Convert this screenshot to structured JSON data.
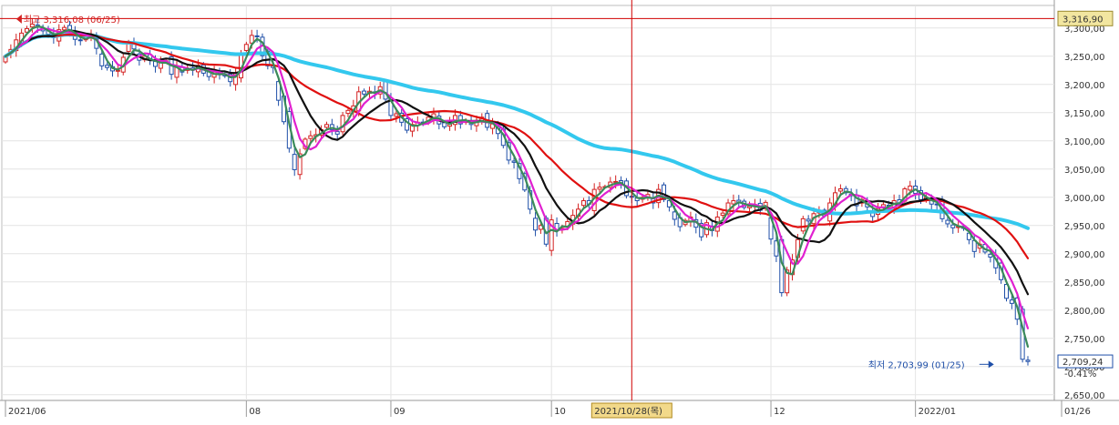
{
  "colors": {
    "up": "#d32020",
    "down": "#1f4fa8",
    "crosshair": "#d00000",
    "grid": "#e4e4e4",
    "ma_green": "#3b8a5a",
    "ma_magenta": "#e020d0",
    "ma_black": "#111111",
    "ma_red": "#e01010",
    "ma_cyan": "#33c8ee",
    "current_box": "#f2e6a0",
    "date_box": "#f2d98a"
  },
  "chart_data": {
    "type": "candlestick",
    "y_ticks": [
      "3,300,00",
      "3,250,00",
      "3,200,00",
      "3,150,00",
      "3,100,00",
      "3,050,00",
      "3,000,00",
      "2,950,00",
      "2,900,00",
      "2,850,00",
      "2,800,00",
      "2,750,00",
      "2,700,00",
      "2,650,00"
    ],
    "y_tick_values": [
      3300,
      3250,
      3200,
      3150,
      3100,
      3050,
      3000,
      2950,
      2900,
      2850,
      2800,
      2750,
      2700,
      2650
    ],
    "ylim": [
      2640,
      3340
    ],
    "x_ticks": [
      {
        "label": "2021/06",
        "date": "2021-06"
      },
      {
        "label": "08",
        "date": "2021-08"
      },
      {
        "label": "09",
        "date": "2021-09"
      },
      {
        "label": "10",
        "date": "2021-10"
      },
      {
        "label": "12",
        "date": "2021-12"
      },
      {
        "label": "2022/01",
        "date": "2022-01"
      },
      {
        "label": "01/26",
        "date": "2022-01-26"
      }
    ],
    "x_tick_index": [
      0,
      45,
      72,
      102,
      143,
      170,
      195
    ],
    "high_annotation": {
      "text": "최고 3,316,08 (06/25)",
      "value": 3316.08,
      "date": "06/25",
      "index": 1
    },
    "low_annotation": {
      "text": "최저 2,703,99 (01/25)",
      "value": 2703.99,
      "date": "01/25",
      "index": 185
    },
    "current_price": {
      "label": "3,316,90",
      "value": 3316.9
    },
    "last_price": {
      "label": "2,709,24",
      "value": 2709.24
    },
    "last_change": "-0.41%",
    "crosshair": {
      "label": "2021/10/28(목)",
      "index": 117
    },
    "close": [
      3250,
      3262,
      3279,
      3291,
      3299,
      3307,
      3302,
      3295,
      3289,
      3283,
      3297,
      3301,
      3293,
      3280,
      3278,
      3285,
      3288,
      3264,
      3233,
      3230,
      3224,
      3225,
      3248,
      3272,
      3263,
      3243,
      3250,
      3243,
      3232,
      3241,
      3242,
      3218,
      3232,
      3222,
      3229,
      3226,
      3234,
      3220,
      3214,
      3222,
      3218,
      3215,
      3205,
      3220,
      3253,
      3271,
      3287,
      3285,
      3251,
      3233,
      3230,
      3172,
      3134,
      3087,
      3049,
      3077,
      3103,
      3109,
      3111,
      3120,
      3129,
      3120,
      3112,
      3145,
      3154,
      3162,
      3187,
      3183,
      3188,
      3185,
      3196,
      3174,
      3145,
      3148,
      3133,
      3119,
      3129,
      3133,
      3132,
      3142,
      3148,
      3130,
      3125,
      3134,
      3145,
      3130,
      3136,
      3129,
      3134,
      3142,
      3124,
      3130,
      3113,
      3092,
      3066,
      3062,
      3033,
      3013,
      2979,
      2942,
      2950,
      2917,
      2960,
      2941,
      2945,
      2957,
      2968,
      2979,
      2994,
      2988,
      3014,
      3018,
      3019,
      3027,
      3028,
      3023,
      3003,
      3000,
      2994,
      3000,
      3005,
      2990,
      3014,
      2996,
      2983,
      2961,
      2948,
      2959,
      2965,
      2947,
      2930,
      2955,
      2941,
      2965,
      2972,
      2990,
      2994,
      2990,
      2982,
      2984,
      2986,
      2977,
      2991,
      2926,
      2896,
      2831,
      2871,
      2889,
      2925,
      2962,
      2958,
      2971,
      2975,
      2967,
      2990,
      3008,
      3015,
      3008,
      3003,
      2985,
      2996,
      2983,
      2966,
      2980,
      2987,
      2984,
      2994,
      2990,
      3015,
      3020,
      3007,
      2996,
      3000,
      2988,
      2987,
      2962,
      2953,
      2946,
      2948,
      2945,
      2925,
      2904,
      2917,
      2903,
      2894,
      2875,
      2854,
      2821,
      2812,
      2784,
      2713,
      2709
    ]
  }
}
